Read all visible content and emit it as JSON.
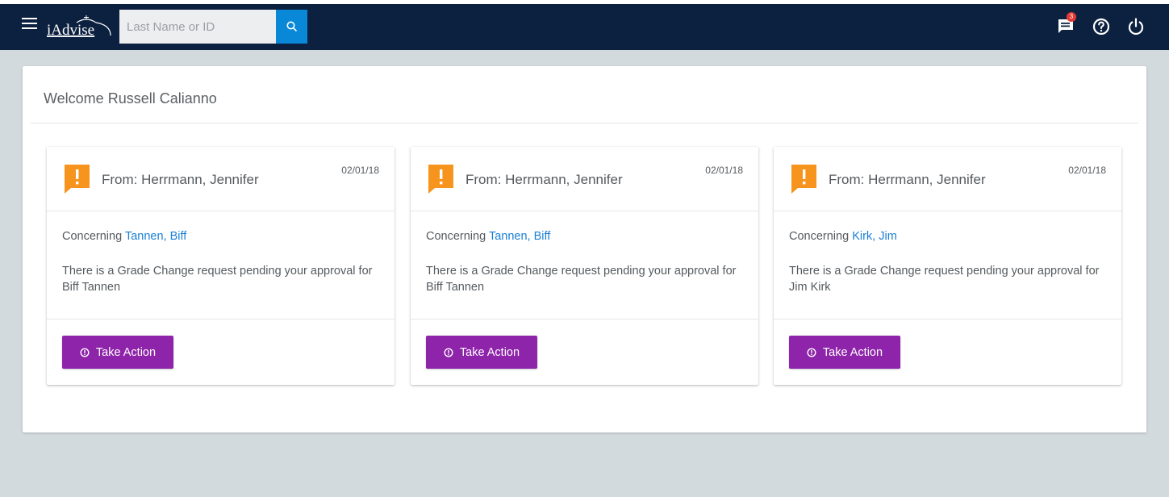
{
  "header": {
    "logo_text": "iAdvise",
    "search_placeholder": "Last Name or ID",
    "notification_count": "3",
    "icons": [
      "menu-icon",
      "search-icon",
      "chat-notification-icon",
      "help-icon",
      "power-icon"
    ]
  },
  "welcome": "Welcome Russell Calianno",
  "cards": [
    {
      "from": "From: Herrmann, Jennifer",
      "date": "02/01/18",
      "concerning_label": "Concerning",
      "concerning_name": "Tannen, Biff",
      "message": "There is a Grade Change request pending your approval for Biff Tannen",
      "action_label": "Take Action"
    },
    {
      "from": "From: Herrmann, Jennifer",
      "date": "02/01/18",
      "concerning_label": "Concerning",
      "concerning_name": "Tannen, Biff",
      "message": "There is a Grade Change request pending your approval for Biff Tannen",
      "action_label": "Take Action"
    },
    {
      "from": "From: Herrmann, Jennifer",
      "date": "02/01/18",
      "concerning_label": "Concerning",
      "concerning_name": "Kirk, Jim",
      "message": "There is a Grade Change request pending your approval for Jim Kirk",
      "action_label": "Take Action"
    }
  ],
  "colors": {
    "topbar": "#0c2140",
    "search_button": "#0a88d8",
    "alert_icon": "#f7941d",
    "action_button": "#8e24aa",
    "link": "#1a7fd4"
  }
}
